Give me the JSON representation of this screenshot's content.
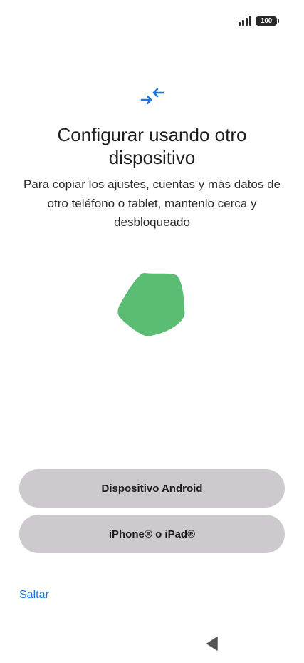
{
  "status_bar": {
    "battery_level": "100",
    "signal_bars": 4
  },
  "header": {
    "icon": "transfer-arrows-icon",
    "title": "Configurar usando otro dispositivo",
    "subtitle": "Para copiar los ajustes, cuentas y más datos de otro teléfono o tablet, mantenlo cerca y desbloqueado"
  },
  "illustration": {
    "icon": "connecting-animation-shape",
    "color": "#5bbd74"
  },
  "actions": {
    "android_label": "Dispositivo Android",
    "iphone_label": "iPhone® o iPad®",
    "skip_label": "Saltar"
  },
  "navigation": {
    "back_icon": "back-triangle-icon"
  },
  "colors": {
    "accent": "#1a73e8",
    "button_background": "#cdc9ce",
    "background": "#ffffff"
  }
}
